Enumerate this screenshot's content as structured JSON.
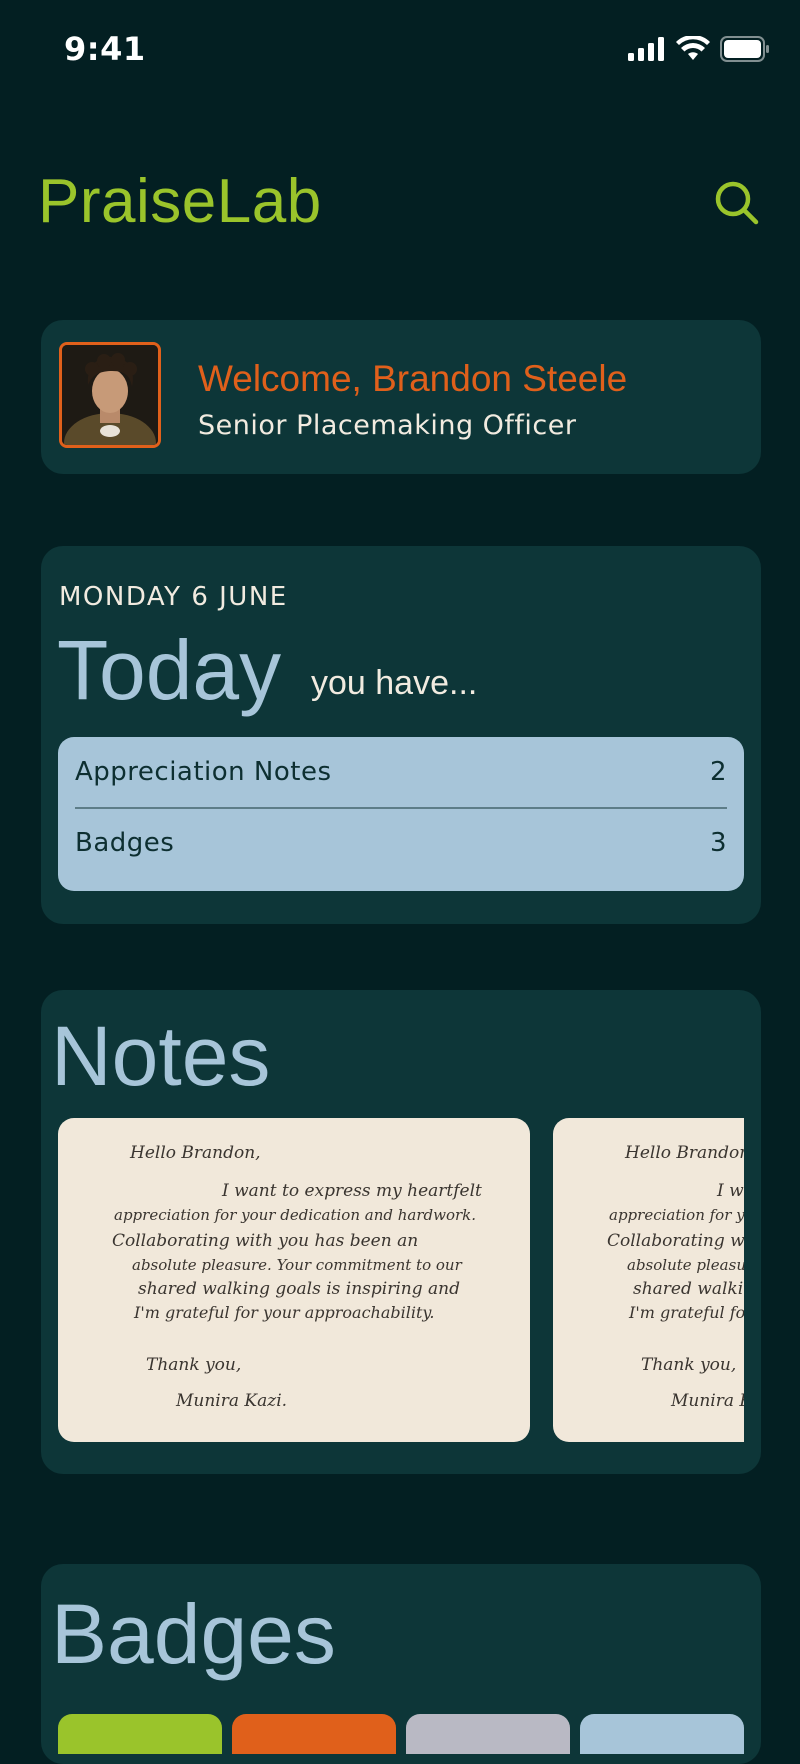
{
  "status_bar": {
    "time": "9:41"
  },
  "header": {
    "title": "PraiseLab"
  },
  "welcome": {
    "name": "Welcome, Brandon Steele",
    "role": "Senior Placemaking Officer"
  },
  "today": {
    "date": "MONDAY 6 JUNE",
    "heading": "Today",
    "subheading": "you have...",
    "items": [
      {
        "label": "Appreciation Notes",
        "count": "2"
      },
      {
        "label": "Badges",
        "count": "3"
      }
    ]
  },
  "notes": {
    "title": "Notes",
    "cards": [
      {
        "lines": [
          "Hello Brandon,",
          "I want to express my heartfelt",
          "appreciation for your dedication and hardwork.",
          "Collaborating with you has been an",
          "absolute pleasure. Your commitment to our",
          "shared walking goals is inspiring and",
          "I'm grateful for your approachability.",
          "Thank you,",
          "Munira Kazi."
        ]
      },
      {
        "lines": [
          "Hello Brandon,",
          "I want to express my heartfelt",
          "appreciation for your dedication and hardwork.",
          "Collaborating with you has been an",
          "absolute pleasure. Your commitment to our",
          "shared walking goals is inspiring and",
          "I'm grateful for your approachability.",
          "Thank you,",
          "Munira Kazi."
        ]
      }
    ]
  },
  "badges": {
    "title": "Badges",
    "colors": [
      "#9ac42b",
      "#e0601b",
      "#b9b9c4",
      "#a7c5d9"
    ]
  },
  "colors": {
    "background": "#031f22",
    "card": "#0d3638",
    "accent_green": "#9ac42b",
    "accent_orange": "#e0601b",
    "accent_blue": "#a7c5d9",
    "paper": "#f1e8da"
  },
  "icons": {
    "signal": "signal-icon",
    "wifi": "wifi-icon",
    "battery": "battery-icon",
    "search": "search-icon"
  }
}
